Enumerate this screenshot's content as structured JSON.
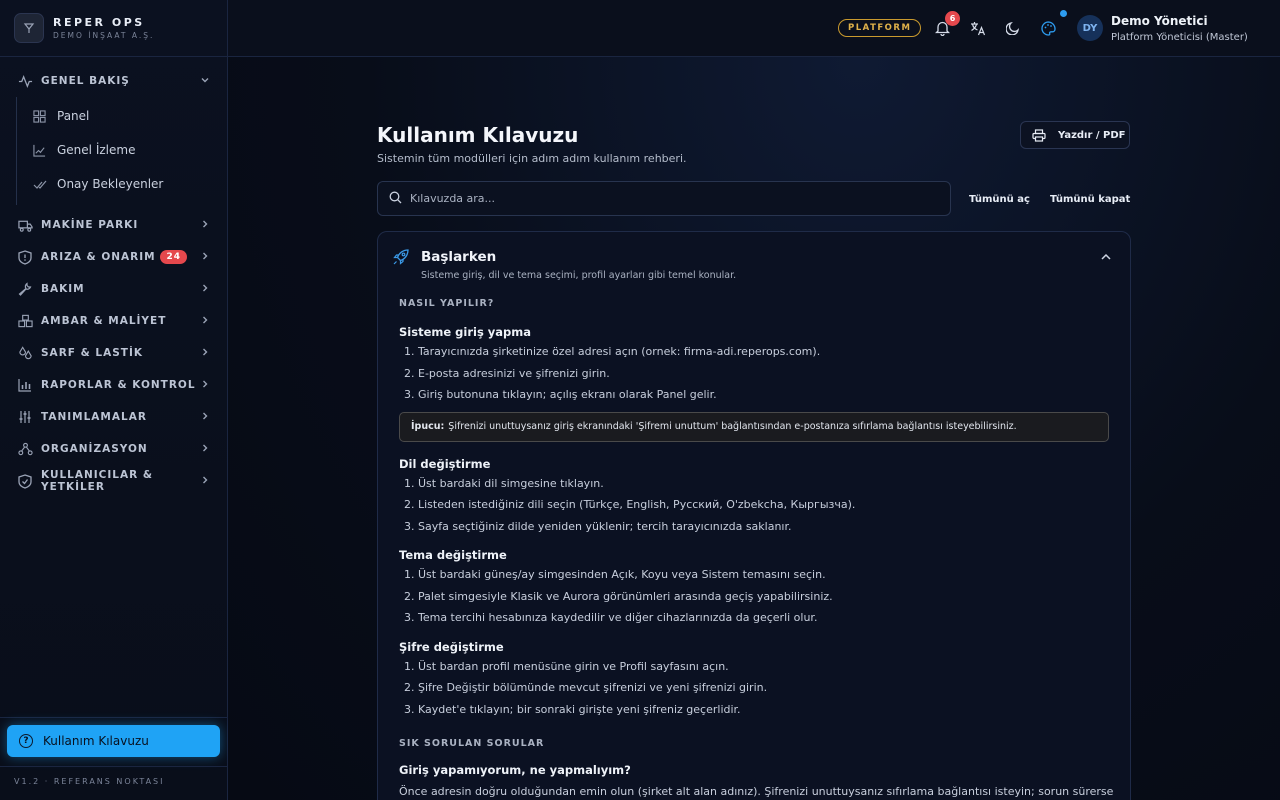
{
  "brand": {
    "name": "REPER OPS",
    "sub": "DEMO İNŞAAT A.Ş."
  },
  "sidebar": {
    "groups": [
      {
        "label": "GENEL BAKIŞ",
        "icon": "activity-icon",
        "expanded": true,
        "items": [
          {
            "label": "Panel",
            "icon": "dashboard-icon"
          },
          {
            "label": "Genel İzleme",
            "icon": "chart-line-icon"
          },
          {
            "label": "Onay Bekleyenler",
            "icon": "check-double-icon"
          }
        ]
      },
      {
        "label": "MAKİNE PARKI",
        "icon": "truck-icon"
      },
      {
        "label": "ARIZA & ONARIM",
        "icon": "alert-shield-icon",
        "badge": "24"
      },
      {
        "label": "BAKIM",
        "icon": "wrench-icon"
      },
      {
        "label": "AMBAR & MALİYET",
        "icon": "boxes-icon"
      },
      {
        "label": "SARF & LASTİK",
        "icon": "drops-icon"
      },
      {
        "label": "RAPORLAR & KONTROL",
        "icon": "bar-chart-icon"
      },
      {
        "label": "TANIMLAMALAR",
        "icon": "sliders-icon"
      },
      {
        "label": "ORGANİZASYON",
        "icon": "org-chart-icon"
      },
      {
        "label": "KULLANICILAR & YETKİLER",
        "icon": "shield-check-icon"
      }
    ],
    "guide_label": "Kullanım Kılavuzu",
    "version": "V1.2 · REFERANS NOKTASI"
  },
  "topbar": {
    "platform_pill": "PLATFORM",
    "notification_count": "6",
    "avatar_initials": "DY",
    "user_name": "Demo Yönetici",
    "user_role": "Platform Yöneticisi (Master)"
  },
  "main": {
    "title": "Kullanım Kılavuzu",
    "subtitle": "Sistemin tüm modülleri için adım adım kullanım rehberi.",
    "print_label": "Yazdır / PDF",
    "search_placeholder": "Kılavuzda ara...",
    "expand_all": "Tümünü aç",
    "collapse_all": "Tümünü kapat",
    "card": {
      "title": "Başlarken",
      "description": "Sisteme giriş, dil ve tema seçimi, profil ayarları gibi temel konular.",
      "howto_label": "NASIL YAPILIR?",
      "topics": [
        {
          "title": "Sisteme giriş yapma",
          "steps": [
            "1. Tarayıcınızda şirketinize özel adresi açın (ornek: firma-adi.reperops.com).",
            "2. E-posta adresinizi ve şifrenizi girin.",
            "3. Giriş butonuna tıklayın; açılış ekranı olarak Panel gelir."
          ],
          "tip_label": "İpucu:",
          "tip_text": "Şifrenizi unuttuysanız giriş ekranındaki 'Şifremi unuttum' bağlantısından e-postanıza sıfırlama bağlantısı isteyebilirsiniz."
        },
        {
          "title": "Dil değiştirme",
          "steps": [
            "1. Üst bardaki dil simgesine tıklayın.",
            "2. Listeden istediğiniz dili seçin (Türkçe, English, Русский, O'zbekcha, Кыргызча).",
            "3. Sayfa seçtiğiniz dilde yeniden yüklenir; tercih tarayıcınızda saklanır."
          ]
        },
        {
          "title": "Tema değiştirme",
          "steps": [
            "1. Üst bardaki güneş/ay simgesinden Açık, Koyu veya Sistem temasını seçin.",
            "2. Palet simgesiyle Klasik ve Aurora görünümleri arasında geçiş yapabilirsiniz.",
            "3. Tema tercihi hesabınıza kaydedilir ve diğer cihazlarınızda da geçerli olur."
          ]
        },
        {
          "title": "Şifre değiştirme",
          "steps": [
            "1. Üst bardan profil menüsüne girin ve Profil sayfasını açın.",
            "2. Şifre Değiştir bölümünde mevcut şifrenizi ve yeni şifrenizi girin.",
            "3. Kaydet'e tıklayın; bir sonraki girişte yeni şifreniz geçerlidir."
          ]
        }
      ],
      "faq_label": "SIK SORULAN SORULAR",
      "faq_question": "Giriş yapamıyorum, ne yapmalıyım?",
      "faq_answer": "Önce adresin doğru olduğundan emin olun (şirket alt alan adınız). Şifrenizi unuttuysanız sıfırlama bağlantısı isteyin; sorun sürerse"
    }
  },
  "colors": {
    "accent": "#1fa3f5",
    "badge": "#e5484d",
    "platform": "#e0b24a",
    "background": "#070b16"
  }
}
